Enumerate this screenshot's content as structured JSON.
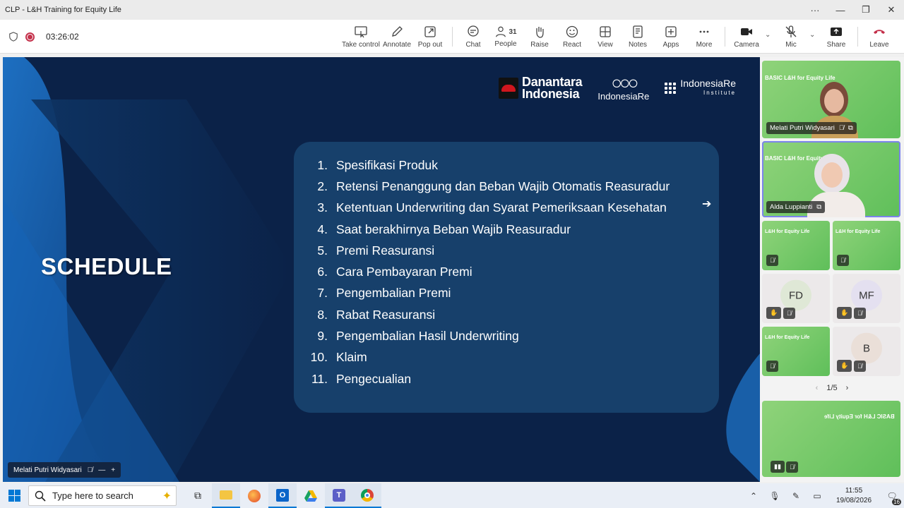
{
  "window": {
    "title": "CLP - L&H Training for Equity Life",
    "controls": [
      "more",
      "minimize",
      "restore",
      "close"
    ]
  },
  "meeting": {
    "timer": "03:26:02"
  },
  "toolbar": {
    "take_control": "Take control",
    "annotate": "Annotate",
    "pop_out": "Pop out",
    "chat": "Chat",
    "people": "People",
    "people_count": "31",
    "raise": "Raise",
    "react": "React",
    "view": "View",
    "notes": "Notes",
    "apps": "Apps",
    "more": "More",
    "camera": "Camera",
    "mic": "Mic",
    "share": "Share",
    "leave": "Leave",
    "leave_color": "#c4314b"
  },
  "slide": {
    "heading": "SCHEDULE",
    "logos": {
      "danantara_line1": "Danantara",
      "danantara_line2": "Indonesia",
      "indonesiare": "IndonesiaRe",
      "institute_name": "IndonesiaRe",
      "institute_sub": "Institute"
    },
    "items": [
      {
        "n": "1.",
        "text": "Spesifikasi Produk"
      },
      {
        "n": "2.",
        "text": "Retensi Penanggung dan Beban Wajib Otomatis Reasuradur"
      },
      {
        "n": "3.",
        "text": "Ketentuan Underwriting dan Syarat Pemeriksaan Kesehatan"
      },
      {
        "n": "4.",
        "text": "Saat berakhirnya Beban Wajib Reasuradur"
      },
      {
        "n": "5.",
        "text": "Premi Reasuransi"
      },
      {
        "n": "6.",
        "text": "Cara Pembayaran Premi"
      },
      {
        "n": "7.",
        "text": "Pengembalian Premi"
      },
      {
        "n": "8.",
        "text": "Rabat Reasuransi"
      },
      {
        "n": "9.",
        "text": "Pengembalian Hasil Underwriting"
      },
      {
        "n": "10.",
        "text": "Klaim"
      },
      {
        "n": "11.",
        "text": "Pengecualian"
      }
    ],
    "presenter_tag": "Melati Putri Widyasari"
  },
  "participants": {
    "tile1": {
      "name": "Melati Putri Widyasari",
      "banner": "BASIC L&H for Equity Life"
    },
    "tile2": {
      "name": "Alda Luppianti",
      "banner": "BASIC L&H for Equity Life"
    },
    "tile3": {
      "banner": "L&H for Equity Life"
    },
    "tile4": {
      "banner": "L&H for Equity Life"
    },
    "tile5": {
      "initials": "FD"
    },
    "tile6": {
      "initials": "MF"
    },
    "tile7": {
      "banner": "L&H for Equity Life"
    },
    "tile8": {
      "initials": "B"
    },
    "self": {
      "banner": "BASIC L&H for Equity Life"
    },
    "pager": "1/5"
  },
  "taskbar": {
    "search_placeholder": "Type here to search",
    "time": "11:55",
    "date": "19/08/2026",
    "notifications": "16"
  }
}
